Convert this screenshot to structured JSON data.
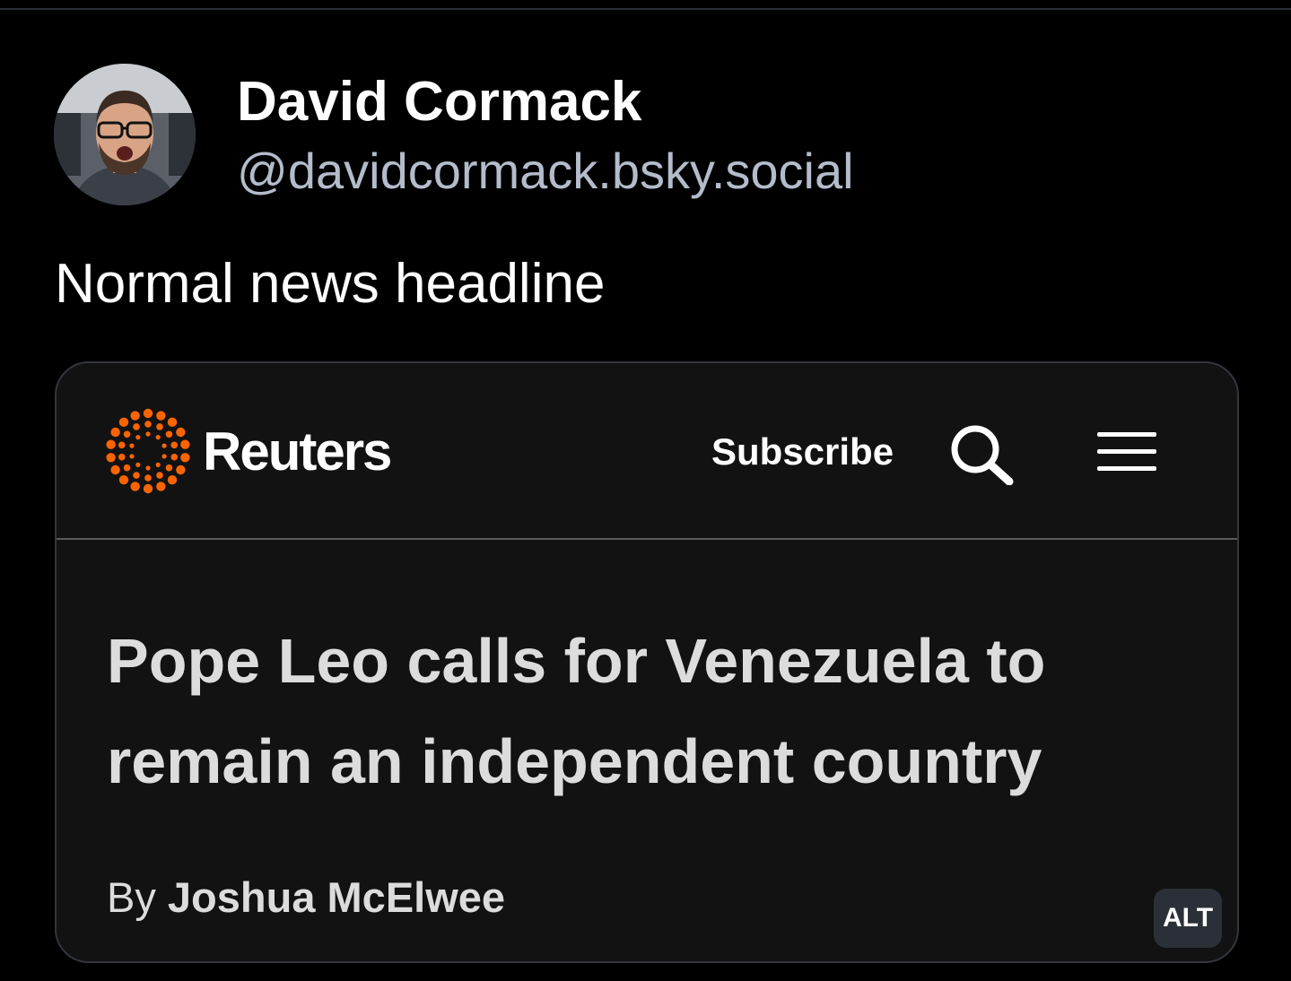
{
  "author": {
    "display_name": "David Cormack",
    "handle": "@davidcormack.bsky.social"
  },
  "post": {
    "text": "Normal news headline"
  },
  "embed": {
    "site_name": "Reuters",
    "subscribe_label": "Subscribe",
    "search_icon": "search-icon",
    "menu_icon": "hamburger-menu-icon",
    "headline": "Pope Leo calls for Venezuela to remain an independent country",
    "byline_prefix": "By",
    "byline_author": "Joshua McElwee",
    "brand_color": "#fa6400"
  },
  "alt_badge": "ALT",
  "colors": {
    "background": "#000000",
    "handle": "#b4bccb",
    "embed_background": "#121212"
  }
}
